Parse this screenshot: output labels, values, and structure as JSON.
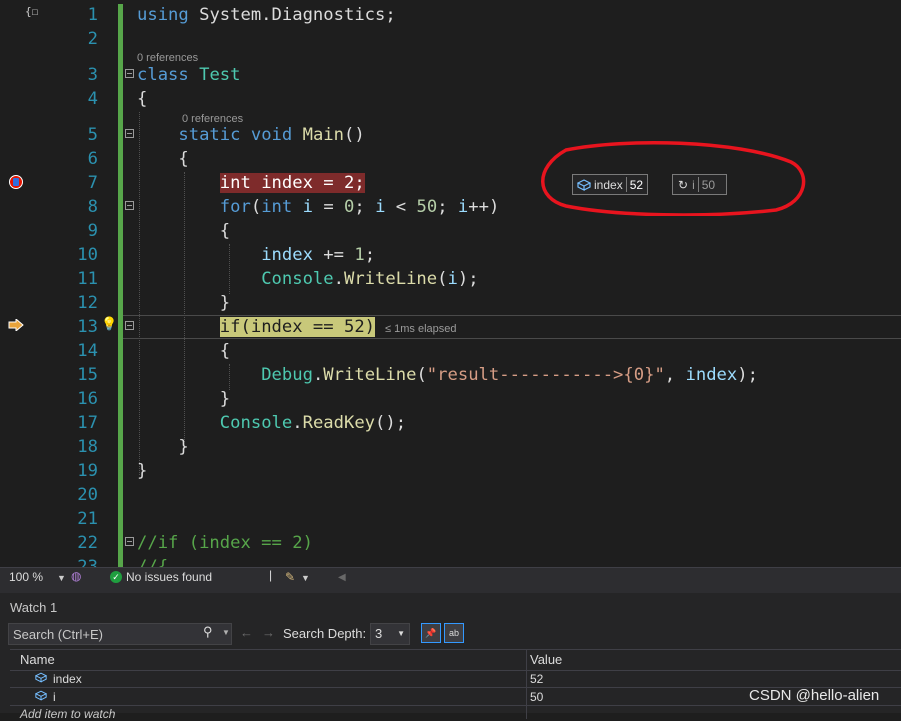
{
  "editor": {
    "lines": [
      {
        "n": "1",
        "tokens": [
          {
            "t": "using",
            "c": "kw"
          },
          {
            "t": " System.Diagnostics;",
            "c": ""
          }
        ]
      },
      {
        "n": "2",
        "tokens": []
      },
      {
        "n": "3",
        "tokens": [
          {
            "t": "class",
            "c": "kw"
          },
          {
            "t": " ",
            "c": ""
          },
          {
            "t": "Test",
            "c": "ty"
          }
        ]
      },
      {
        "n": "4",
        "tokens": [
          {
            "t": "{",
            "c": ""
          }
        ]
      },
      {
        "n": "5",
        "tokens": [
          {
            "t": "    static",
            "c": "kw"
          },
          {
            "t": " ",
            "c": ""
          },
          {
            "t": "void",
            "c": "kw"
          },
          {
            "t": " ",
            "c": ""
          },
          {
            "t": "Main",
            "c": "fn"
          },
          {
            "t": "()",
            "c": ""
          }
        ]
      },
      {
        "n": "6",
        "tokens": [
          {
            "t": "    {",
            "c": ""
          }
        ]
      },
      {
        "n": "7",
        "tokens": [
          {
            "t": "        ",
            "c": ""
          },
          {
            "t": "int index = 2;",
            "c": "bp-line"
          }
        ]
      },
      {
        "n": "8",
        "tokens": [
          {
            "t": "        ",
            "c": ""
          },
          {
            "t": "for",
            "c": "kw"
          },
          {
            "t": "(",
            "c": ""
          },
          {
            "t": "int",
            "c": "kw"
          },
          {
            "t": " ",
            "c": ""
          },
          {
            "t": "i",
            "c": "vr"
          },
          {
            "t": " = ",
            "c": ""
          },
          {
            "t": "0",
            "c": "nm"
          },
          {
            "t": "; ",
            "c": ""
          },
          {
            "t": "i",
            "c": "vr"
          },
          {
            "t": " < ",
            "c": ""
          },
          {
            "t": "50",
            "c": "nm"
          },
          {
            "t": "; ",
            "c": ""
          },
          {
            "t": "i",
            "c": "vr"
          },
          {
            "t": "++)",
            "c": ""
          }
        ]
      },
      {
        "n": "9",
        "tokens": [
          {
            "t": "        {",
            "c": ""
          }
        ]
      },
      {
        "n": "10",
        "tokens": [
          {
            "t": "            ",
            "c": ""
          },
          {
            "t": "index",
            "c": "vr"
          },
          {
            "t": " += ",
            "c": ""
          },
          {
            "t": "1",
            "c": "nm"
          },
          {
            "t": ";",
            "c": ""
          }
        ]
      },
      {
        "n": "11",
        "tokens": [
          {
            "t": "            ",
            "c": ""
          },
          {
            "t": "Console",
            "c": "ty"
          },
          {
            "t": ".",
            "c": ""
          },
          {
            "t": "WriteLine",
            "c": "fn"
          },
          {
            "t": "(",
            "c": ""
          },
          {
            "t": "i",
            "c": "vr"
          },
          {
            "t": ");",
            "c": ""
          }
        ]
      },
      {
        "n": "12",
        "tokens": [
          {
            "t": "        }",
            "c": ""
          }
        ]
      },
      {
        "n": "13",
        "tokens": [
          {
            "t": "        ",
            "c": ""
          },
          {
            "t": "if(index == 52)",
            "c": "cur-line"
          }
        ]
      },
      {
        "n": "14",
        "tokens": [
          {
            "t": "        {",
            "c": ""
          }
        ]
      },
      {
        "n": "15",
        "tokens": [
          {
            "t": "            ",
            "c": ""
          },
          {
            "t": "Debug",
            "c": "ty"
          },
          {
            "t": ".",
            "c": ""
          },
          {
            "t": "WriteLine",
            "c": "fn"
          },
          {
            "t": "(",
            "c": ""
          },
          {
            "t": "\"result----------->{0}\"",
            "c": "st"
          },
          {
            "t": ", ",
            "c": ""
          },
          {
            "t": "index",
            "c": "vr"
          },
          {
            "t": ");",
            "c": ""
          }
        ]
      },
      {
        "n": "16",
        "tokens": [
          {
            "t": "        }",
            "c": ""
          }
        ]
      },
      {
        "n": "17",
        "tokens": [
          {
            "t": "        ",
            "c": ""
          },
          {
            "t": "Console",
            "c": "ty"
          },
          {
            "t": ".",
            "c": ""
          },
          {
            "t": "ReadKey",
            "c": "fn"
          },
          {
            "t": "();",
            "c": ""
          }
        ]
      },
      {
        "n": "18",
        "tokens": [
          {
            "t": "    }",
            "c": ""
          }
        ]
      },
      {
        "n": "19",
        "tokens": [
          {
            "t": "}",
            "c": ""
          }
        ]
      },
      {
        "n": "20",
        "tokens": []
      },
      {
        "n": "21",
        "tokens": []
      },
      {
        "n": "22",
        "tokens": [
          {
            "t": "//if (index == 2)",
            "c": "cm"
          }
        ]
      },
      {
        "n": "23",
        "tokens": [
          {
            "t": "//{",
            "c": "cm"
          }
        ]
      }
    ],
    "references_label": "0 references",
    "elapsed_label": "≤ 1ms elapsed",
    "datatips": [
      {
        "name": "index",
        "value": "52"
      },
      {
        "name": "i",
        "value": "50"
      }
    ],
    "colors": {
      "breakpoint": "#e51400",
      "annotation_ellipse": "#e8141e",
      "change_bar": "#57a64a"
    }
  },
  "status": {
    "zoom": "100 %",
    "issues": "No issues found"
  },
  "watch": {
    "title": "Watch 1",
    "search_placeholder": "Search (Ctrl+E)",
    "search_depth_label": "Search Depth:",
    "search_depth_value": "3",
    "columns": {
      "name": "Name",
      "value": "Value"
    },
    "rows": [
      {
        "name": "index",
        "value": "52"
      },
      {
        "name": "i",
        "value": "50"
      }
    ],
    "add_item": "Add item to watch"
  },
  "watermark": "CSDN @hello-alien"
}
